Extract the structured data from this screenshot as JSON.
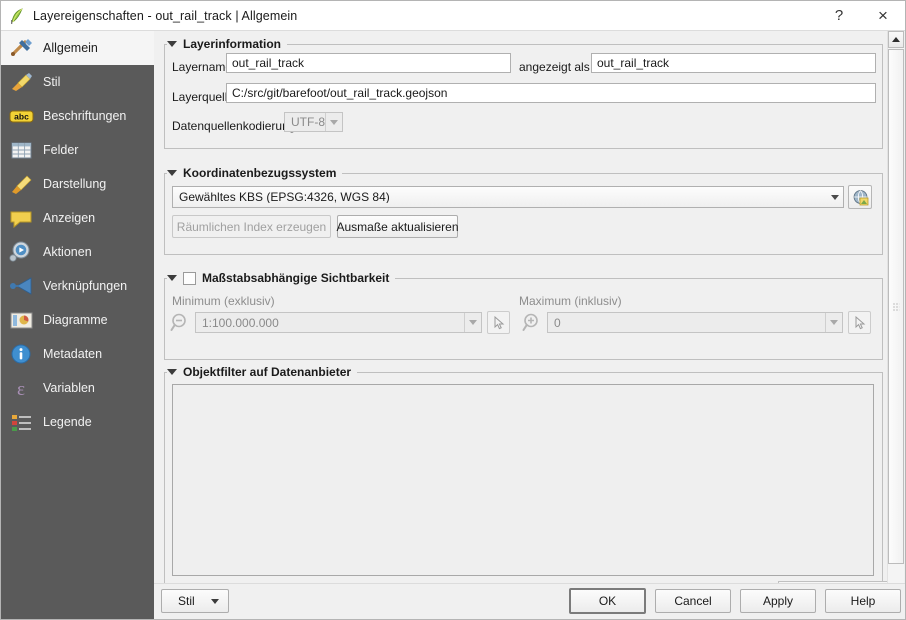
{
  "window": {
    "title": "Layereigenschaften - out_rail_track | Allgemein",
    "icon": "qgis-logo-icon",
    "help_button": "?",
    "close_button": "×"
  },
  "sidebar": {
    "items": [
      {
        "label": "Allgemein",
        "icon": "hammer-wrench-icon",
        "selected": true
      },
      {
        "label": "Stil",
        "icon": "paintbrush-icon",
        "selected": false
      },
      {
        "label": "Beschriftungen",
        "icon": "abc-label-icon",
        "selected": false
      },
      {
        "label": "Felder",
        "icon": "table-grid-icon",
        "selected": false
      },
      {
        "label": "Darstellung",
        "icon": "brush-render-icon",
        "selected": false
      },
      {
        "label": "Anzeigen",
        "icon": "speech-bubble-icon",
        "selected": false
      },
      {
        "label": "Aktionen",
        "icon": "gear-play-icon",
        "selected": false
      },
      {
        "label": "Verknüpfungen",
        "icon": "join-arrow-icon",
        "selected": false
      },
      {
        "label": "Diagramme",
        "icon": "chart-picture-icon",
        "selected": false
      },
      {
        "label": "Metadaten",
        "icon": "info-circle-icon",
        "selected": false
      },
      {
        "label": "Variablen",
        "icon": "epsilon-icon",
        "selected": false
      },
      {
        "label": "Legende",
        "icon": "legend-list-icon",
        "selected": false
      }
    ]
  },
  "layer_information": {
    "group_title": "Layerinformation",
    "layername_label": "Layername",
    "layername_value": "out_rail_track",
    "displayed_as_label": "angezeigt als",
    "displayed_as_value": "out_rail_track",
    "layersource_label": "Layerquelle",
    "layersource_value": "C:/src/git/barefoot/out_rail_track.geojson",
    "encoding_label": "Datenquellenkodierung",
    "encoding_value": "UTF-8"
  },
  "crs": {
    "group_title": "Koordinatenbezugssystem",
    "selected_crs": "Gewähltes KBS (EPSG:4326, WGS 84)",
    "crs_picker_icon": "crs-globe-icon",
    "spatial_index_button": "Räumlichen Index erzeugen",
    "update_extents_button": "Ausmaße aktualisieren"
  },
  "scale_visibility": {
    "group_title": "Maßstabsabhängige Sichtbarkeit",
    "enabled": false,
    "minimum_label": "Minimum (exklusiv)",
    "minimum_value": "1:100.000.000",
    "minimum_icon": "zoom-out-icon",
    "maximum_label": "Maximum (inklusiv)",
    "maximum_value": "0",
    "maximum_icon": "zoom-in-icon",
    "pick_from_canvas_icon": "cursor-pick-icon"
  },
  "provider_filter": {
    "group_title": "Objektfilter auf Datenanbieter",
    "value": ""
  },
  "buttons": {
    "style": "Stil",
    "ok": "OK",
    "cancel": "Cancel",
    "apply": "Apply",
    "help": "Help"
  },
  "colors": {
    "sidebar_bg": "#5a5a5a",
    "sidebar_selected_bg": "#f5f5f5",
    "dialog_bg": "#f0f0f0",
    "field_bg": "#ffffff",
    "group_border": "#bfbfbf"
  }
}
